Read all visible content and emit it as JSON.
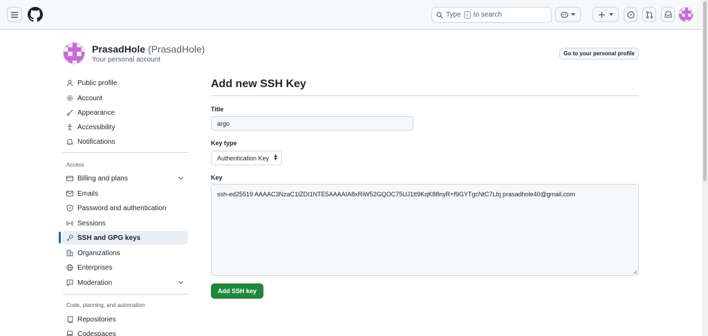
{
  "header": {
    "search_text_before": "Type",
    "search_key": "/",
    "search_text_after": "to search"
  },
  "profile": {
    "name": "PrasadHole",
    "login": "(PrasadHole)",
    "subtitle": "Your personal account",
    "goto_button": "Go to your personal profile"
  },
  "sidebar": {
    "items_top": [
      {
        "label": "Public profile",
        "icon": "person-icon"
      },
      {
        "label": "Account",
        "icon": "gear-icon"
      },
      {
        "label": "Appearance",
        "icon": "paintbrush-icon"
      },
      {
        "label": "Accessibility",
        "icon": "accessibility-icon"
      },
      {
        "label": "Notifications",
        "icon": "bell-icon"
      }
    ],
    "access_heading": "Access",
    "items_access": [
      {
        "label": "Billing and plans",
        "icon": "credit-card-icon"
      },
      {
        "label": "Emails",
        "icon": "mail-icon"
      },
      {
        "label": "Password and authentication",
        "icon": "shield-lock-icon"
      },
      {
        "label": "Sessions",
        "icon": "broadcast-icon"
      },
      {
        "label": "SSH and GPG keys",
        "icon": "key-icon"
      },
      {
        "label": "Organizations",
        "icon": "organization-icon"
      },
      {
        "label": "Enterprises",
        "icon": "globe-icon"
      },
      {
        "label": "Moderation",
        "icon": "report-icon"
      }
    ],
    "code_heading": "Code, planning, and automation",
    "items_code": [
      {
        "label": "Repositories",
        "icon": "repo-icon"
      },
      {
        "label": "Codespaces",
        "icon": "codespaces-icon"
      }
    ]
  },
  "form": {
    "heading": "Add new SSH Key",
    "title_label": "Title",
    "title_value": "argo",
    "key_type_label": "Key type",
    "key_type_value": "Authentication Key",
    "key_label": "Key",
    "key_value": "ssh-ed25519 AAAAC3NzaC1lZDI1NTE5AAAAIA8xRiW52GQOC75UJ1tt9KqK88nyR+f9GYTgcNtC7Lbj prasadhole40@gmail.com",
    "submit_label": "Add SSH key"
  },
  "colors": {
    "accent": "#0969da",
    "primary_button": "#1f883d",
    "avatar": "#c869d9"
  }
}
